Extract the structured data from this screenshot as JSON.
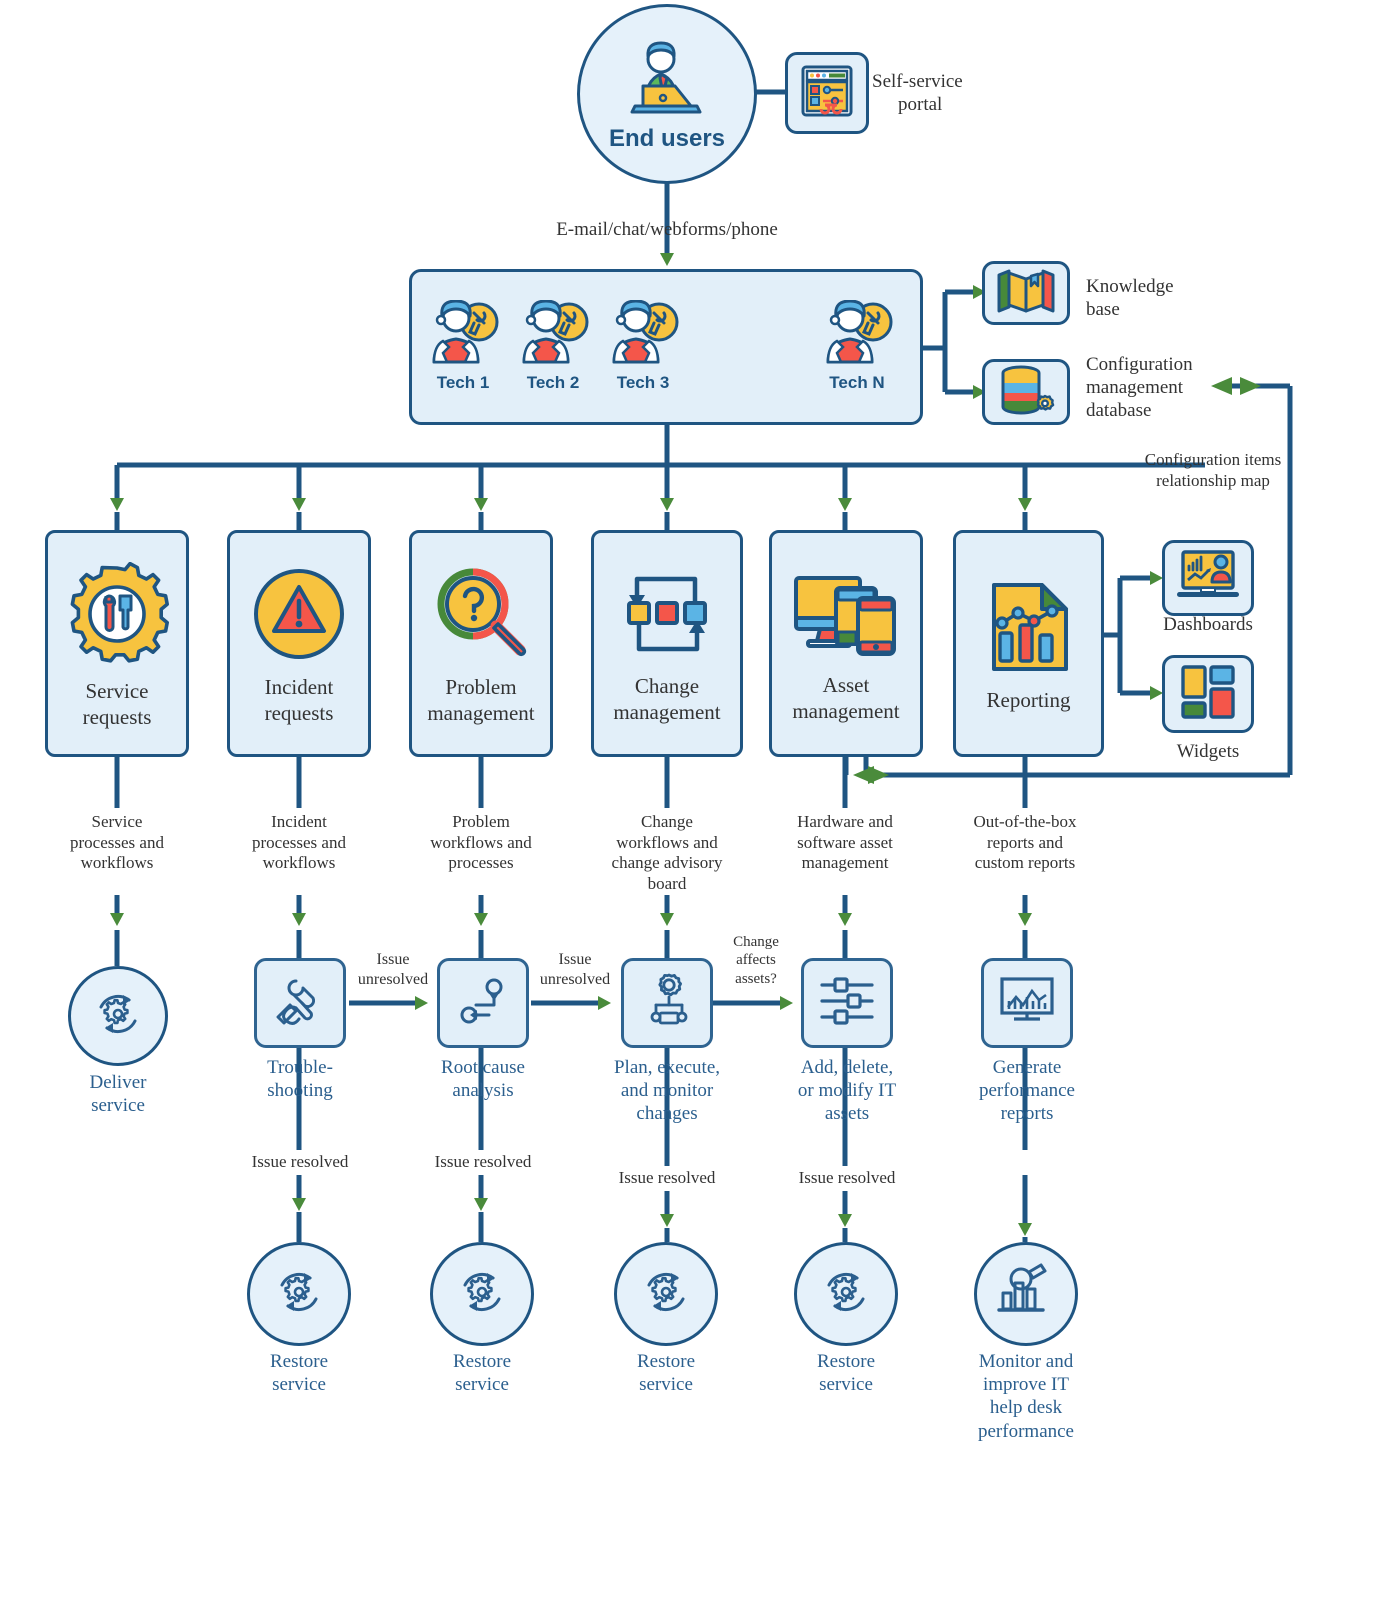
{
  "diagram": {
    "title": "IT help desk workflow",
    "colors": {
      "line": "#1f5582",
      "arrow_green": "#4a8b3b",
      "box_fill": "#e2eff9",
      "box_stroke": "#1f5582",
      "text_blue": "#2b5f8e",
      "accent_yellow": "#f7c33f",
      "accent_red": "#f4564a",
      "accent_blue": "#5bb4e5",
      "accent_green": "#47893a"
    }
  },
  "top": {
    "end_users": {
      "label": "End users",
      "icon": "user-laptop-icon"
    },
    "self_service_portal": {
      "label": "Self-service\nportal",
      "label_line1": "Self-service",
      "label_line2": "portal",
      "icon": "portal-window-icon"
    },
    "channel_label": "E-mail/chat/webforms/phone"
  },
  "technicians": {
    "items": [
      {
        "name": "Tech 1",
        "icon": "technician-icon"
      },
      {
        "name": "Tech 2",
        "icon": "technician-icon"
      },
      {
        "name": "Tech 3",
        "icon": "technician-icon"
      },
      {
        "name": "Tech N",
        "icon": "technician-icon"
      }
    ],
    "ellipsis": "dashed-connector"
  },
  "resources": [
    {
      "label_line1": "Knowledge",
      "label_line2": "base",
      "icon": "knowledge-book-icon"
    },
    {
      "label_line1": "Configuration",
      "label_line2": "management",
      "label_line3": "database",
      "icon": "database-gear-icon"
    }
  ],
  "cmdb_link_label_line1": "Configuration items",
  "cmdb_link_label_line2": "relationship map",
  "modules": [
    {
      "id": "service-requests",
      "line1": "Service",
      "line2": "requests",
      "icon": "gear-tools-icon",
      "flow_label": [
        "Service",
        "processes and",
        "workflows"
      ],
      "step": null,
      "outcome": {
        "line1": "Deliver",
        "line2": "service",
        "icon": "refresh-gear-icon"
      }
    },
    {
      "id": "incident-requests",
      "line1": "Incident",
      "line2": "requests",
      "icon": "warning-triangle-icon",
      "flow_label": [
        "Incident",
        "processes and",
        "workflows"
      ],
      "step": {
        "line1": "Trouble-",
        "line2": "shooting",
        "icon": "hand-wrench-icon"
      },
      "resolved_label": "Issue resolved",
      "unresolved_label": [
        "Issue",
        "unresolved"
      ],
      "outcome": {
        "line1": "Restore",
        "line2": "service",
        "icon": "refresh-gear-icon"
      }
    },
    {
      "id": "problem-management",
      "line1": "Problem",
      "line2": "management",
      "icon": "magnifier-question-icon",
      "flow_label": [
        "Problem",
        "workflows and",
        "processes"
      ],
      "step": {
        "line1": "Root cause",
        "line2": "analysis",
        "icon": "root-cause-icon"
      },
      "resolved_label": "Issue resolved",
      "unresolved_label": [
        "Issue",
        "unresolved"
      ],
      "outcome": {
        "line1": "Restore",
        "line2": "service",
        "icon": "refresh-gear-icon"
      }
    },
    {
      "id": "change-management",
      "line1": "Change",
      "line2": "management",
      "icon": "change-cycle-icon",
      "flow_label": [
        "Change",
        "workflows and",
        "change advisory",
        "board"
      ],
      "step": {
        "line1": "Plan, execute,",
        "line2": "and monitor",
        "line3": "changes",
        "icon": "gear-workflow-icon"
      },
      "resolved_label": "Issue resolved",
      "unresolved_label": [
        "Change",
        "affects",
        "assets?"
      ],
      "outcome": {
        "line1": "Restore",
        "line2": "service",
        "icon": "refresh-gear-icon"
      }
    },
    {
      "id": "asset-management",
      "line1": "Asset",
      "line2": "management",
      "icon": "devices-icon",
      "flow_label": [
        "Hardware and",
        "software asset",
        "management"
      ],
      "step": {
        "line1": "Add, delete,",
        "line2": "or modify IT",
        "line3": "assets",
        "icon": "sliders-icon"
      },
      "resolved_label": "Issue resolved",
      "outcome": {
        "line1": "Restore",
        "line2": "service",
        "icon": "refresh-gear-icon"
      }
    },
    {
      "id": "reporting",
      "line1": "Reporting",
      "line2": "",
      "icon": "report-chart-icon",
      "flow_label": [
        "Out-of-the-box",
        "reports and",
        "custom reports"
      ],
      "step": {
        "line1": "Generate",
        "line2": "performance",
        "line3": "reports",
        "icon": "monitor-chart-icon"
      },
      "outcome": {
        "line1": "Monitor and",
        "line2": "improve IT",
        "line3": "help desk",
        "line4": "performance",
        "icon": "chart-magnifier-icon"
      }
    }
  ],
  "reporting_outputs": [
    {
      "label": "Dashboards",
      "icon": "dashboard-laptop-icon"
    },
    {
      "label": "Widgets",
      "icon": "widgets-grid-icon"
    }
  ]
}
